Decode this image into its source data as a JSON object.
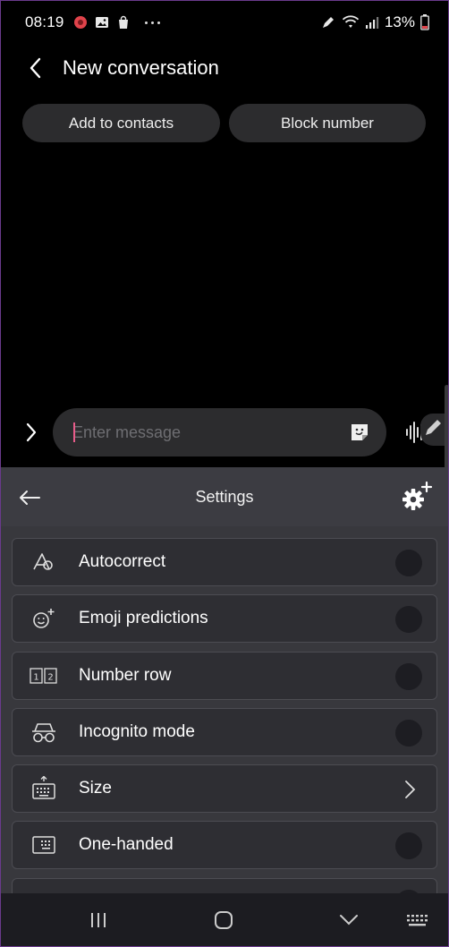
{
  "status_bar": {
    "time": "08:19",
    "battery": "13%",
    "notification_icons": [
      "game-icon",
      "image-icon",
      "shopping-bag-icon",
      "more-dots-icon"
    ],
    "system_icons": [
      "nfc-pen-icon",
      "wifi-icon",
      "signal-icon",
      "battery-icon"
    ]
  },
  "header": {
    "title": "New conversation"
  },
  "actions": {
    "add_contacts": "Add to contacts",
    "block_number": "Block number"
  },
  "composer": {
    "placeholder": "Enter message"
  },
  "keyboard": {
    "panel_title": "Settings",
    "items": [
      {
        "label": "Autocorrect",
        "icon": "autocorrect-icon",
        "control": "toggle",
        "on": false
      },
      {
        "label": "Emoji predictions",
        "icon": "emoji-plus-icon",
        "control": "toggle",
        "on": false
      },
      {
        "label": "Number row",
        "icon": "number-row-icon",
        "control": "toggle",
        "on": false
      },
      {
        "label": "Incognito mode",
        "icon": "incognito-icon",
        "control": "toggle",
        "on": false
      },
      {
        "label": "Size",
        "icon": "keyboard-size-icon",
        "control": "chevron"
      },
      {
        "label": "One-handed",
        "icon": "one-handed-icon",
        "control": "toggle",
        "on": false
      }
    ]
  },
  "colors": {
    "accent_caret": "#e85c8a",
    "panel_bg": "#38383d",
    "row_bg": "#2e2e33"
  }
}
